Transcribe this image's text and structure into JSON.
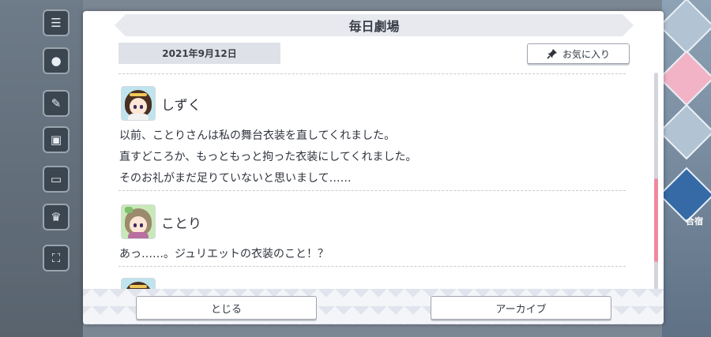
{
  "dialog": {
    "title": "毎日劇場",
    "date": "2021年9月12日",
    "favorite_label": "お気に入り"
  },
  "messages": [
    {
      "speaker": "しずく",
      "lines": [
        "以前、ことりさんは私の舞台衣装を直してくれました。",
        "直すどころか、もっともっと拘った衣装にしてくれました。",
        "そのお礼がまだ足りていないと思いまして……"
      ]
    },
    {
      "speaker": "ことり",
      "lines": [
        "あっ……。ジュリエットの衣装のこと！？"
      ]
    }
  ],
  "scroll": {
    "position_fraction": 0.45
  },
  "footer": {
    "close_label": "とじる",
    "archive_label": "アーカイブ"
  },
  "background": {
    "right_label": "合宿"
  },
  "colors": {
    "accent_pink": "#ef8a9e",
    "title_bar": "#e7e9ef",
    "date_box": "#dfe1e8"
  }
}
